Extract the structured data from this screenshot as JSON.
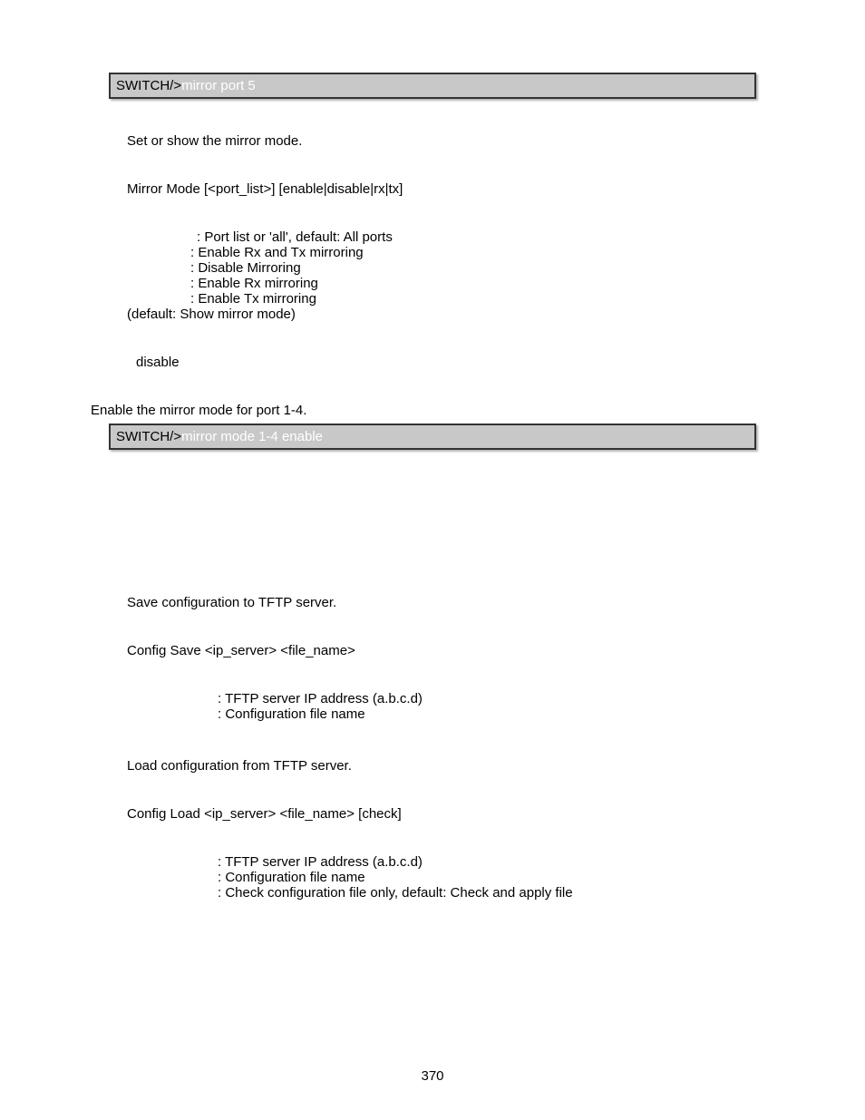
{
  "switch_box1": {
    "prefix": "SWITCH/>",
    "suffix": "mirror port 5"
  },
  "mirror_mode": {
    "desc": "Set or show the mirror mode.",
    "syntax": "Mirror Mode [<port_list>] [enable|disable|rx|tx]",
    "params": {
      "port_list": ": Port list or 'all', default: All ports",
      "enable": ": Enable Rx and Tx mirroring",
      "disable": ": Disable Mirroring",
      "rx": ": Enable Rx mirroring",
      "tx": ": Enable Tx mirroring",
      "default": "(default: Show mirror mode)"
    },
    "default_value": "disable",
    "example_title": "Enable the mirror mode for port 1-4."
  },
  "switch_box2": {
    "prefix": "SWITCH/>",
    "suffix": "mirror mode 1-4 enable"
  },
  "config_save": {
    "desc": "Save configuration to TFTP server.",
    "syntax": "Config Save <ip_server> <file_name>",
    "params": {
      "ip_server": ": TFTP server IP address (a.b.c.d)",
      "file_name": ": Configuration file name"
    }
  },
  "config_load": {
    "desc": "Load configuration from TFTP server.",
    "syntax": "Config Load <ip_server> <file_name> [check]",
    "params": {
      "ip_server": ": TFTP server IP address (a.b.c.d)",
      "file_name": ": Configuration file name",
      "check": ": Check configuration file only, default: Check and apply file"
    }
  },
  "page_number": "370"
}
